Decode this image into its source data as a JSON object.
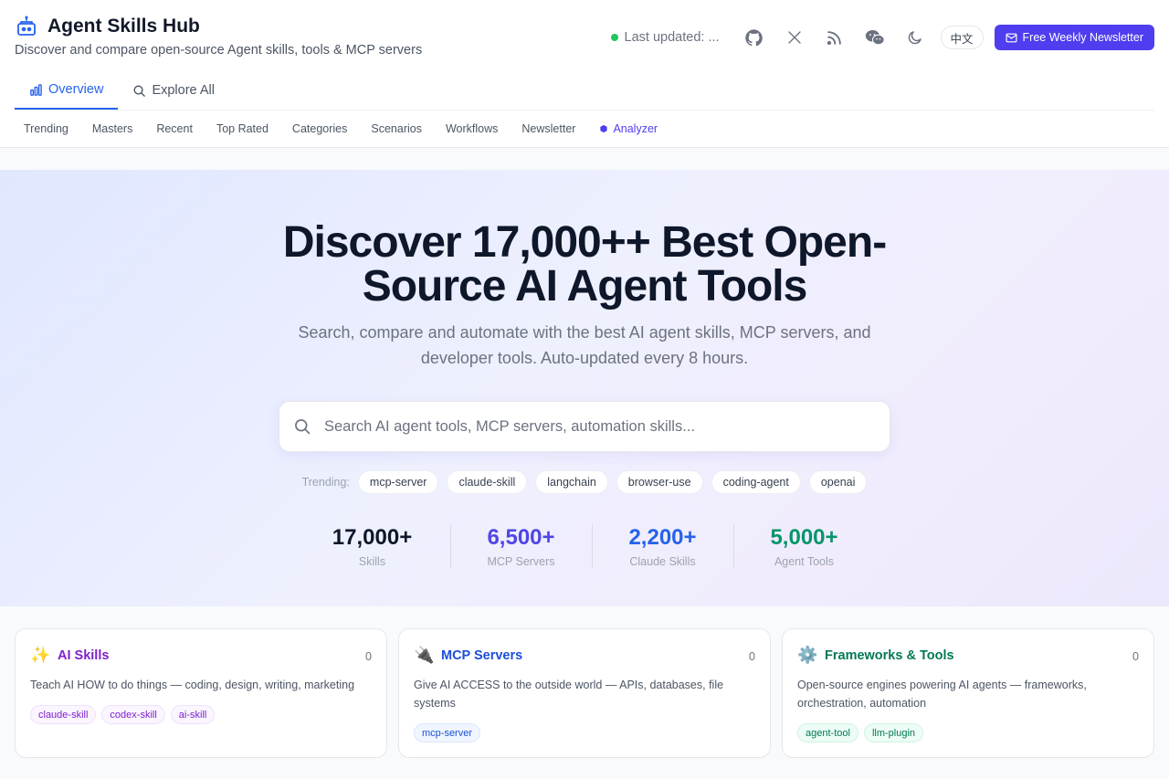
{
  "brand": {
    "title": "Agent Skills Hub",
    "subtitle": "Discover and compare open-source Agent skills, tools & MCP servers"
  },
  "header": {
    "status_text": "Last updated: ...",
    "status_color": "#22c55e",
    "icons": [
      "github-icon",
      "x-icon",
      "rss-icon",
      "wechat-icon",
      "moon-icon"
    ],
    "lang_label": "中文",
    "newsletter_label": "Free Weekly Newsletter"
  },
  "tabs": [
    {
      "label": "Overview",
      "icon": "chart-icon",
      "active": true
    },
    {
      "label": "Explore All",
      "icon": "search-icon",
      "active": false
    }
  ],
  "subnav": [
    {
      "label": "Trending"
    },
    {
      "label": "Masters"
    },
    {
      "label": "Recent"
    },
    {
      "label": "Top Rated"
    },
    {
      "label": "Categories"
    },
    {
      "label": "Scenarios"
    },
    {
      "label": "Workflows"
    },
    {
      "label": "Newsletter"
    },
    {
      "label": "Analyzer",
      "icon": "hexagon-icon"
    }
  ],
  "hero": {
    "title": "Discover 17,000++ Best Open-Source AI Agent Tools",
    "subtitle": "Search, compare and automate with the best AI agent skills, MCP servers, and developer tools. Auto-updated every 8 hours.",
    "search_placeholder": "Search AI agent tools, MCP servers, automation skills...",
    "trending_label": "Trending:",
    "trending": [
      "mcp-server",
      "claude-skill",
      "langchain",
      "browser-use",
      "coding-agent",
      "openai"
    ]
  },
  "stats": [
    {
      "value": "17,000+",
      "label": "Skills",
      "color": "#0f172a"
    },
    {
      "value": "6,500+",
      "label": "MCP Servers",
      "color": "#4f46e5"
    },
    {
      "value": "2,200+",
      "label": "Claude Skills",
      "color": "#2563eb"
    },
    {
      "value": "5,000+",
      "label": "Agent Tools",
      "color": "#059669"
    }
  ],
  "cards": [
    {
      "emoji": "✨",
      "title": "AI Skills",
      "count": "0",
      "color": "#7e22ce",
      "desc": "Teach AI HOW to do things — coding, design, writing, marketing",
      "tags": [
        "claude-skill",
        "codex-skill",
        "ai-skill"
      ],
      "tag_style": "purple"
    },
    {
      "emoji": "🔌",
      "title": "MCP Servers",
      "count": "0",
      "color": "#1d4ed8",
      "desc": "Give AI ACCESS to the outside world — APIs, databases, file systems",
      "tags": [
        "mcp-server"
      ],
      "tag_style": "blue"
    },
    {
      "emoji": "⚙️",
      "title": "Frameworks & Tools",
      "count": "0",
      "color": "#047857",
      "desc": "Open-source engines powering AI agents — frameworks, orchestration, automation",
      "tags": [
        "agent-tool",
        "llm-plugin"
      ],
      "tag_style": "green"
    }
  ]
}
